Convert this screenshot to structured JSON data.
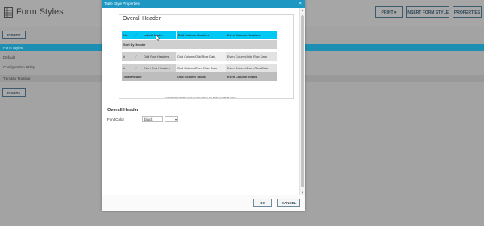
{
  "app": {
    "title": "Form Styles",
    "buttons": {
      "print": "PRINT ▾",
      "insert_form_style": "INSERT FORM STYLE",
      "properties": "PROPERTIES"
    },
    "insert_label": "INSERT",
    "style_list": [
      "Form Styles",
      "Default",
      "Configuration Utility",
      "Tunstan Training"
    ]
  },
  "dialog": {
    "title": "Table Style Properties",
    "close_glyph": "×",
    "preview": {
      "overall_header": "Overall Header",
      "header_row": [
        "No.",
        "✓",
        "Label Header",
        "Odd Column Headers",
        "Even Column Headers"
      ],
      "sort_by_header": "Sort By Header",
      "rows": [
        [
          "#",
          "✓",
          "Odd Row Headers",
          "Odd Column/Odd Row Data",
          "Even Column/Odd Row Data"
        ],
        [
          "#",
          "✓",
          "Even Row Headers",
          "Odd Column/Even Row Data",
          "Even Column/Even Row Data"
        ]
      ],
      "totals_row": [
        "Total Header",
        "Odd Column Totals",
        "Even Column Totals"
      ],
      "note": "Interactive Preview. Click on the cells of the table to change them."
    },
    "section_title": "Overall Header",
    "font_color_label": "Font Color",
    "font_color_value": "black",
    "font_color_select": "▾",
    "ok_label": "OK",
    "cancel_label": "CANCEL"
  },
  "colors": {
    "accent": "#1e97c3",
    "header_cell": "#00c8f5",
    "selected_row": "#1d8fb3"
  }
}
